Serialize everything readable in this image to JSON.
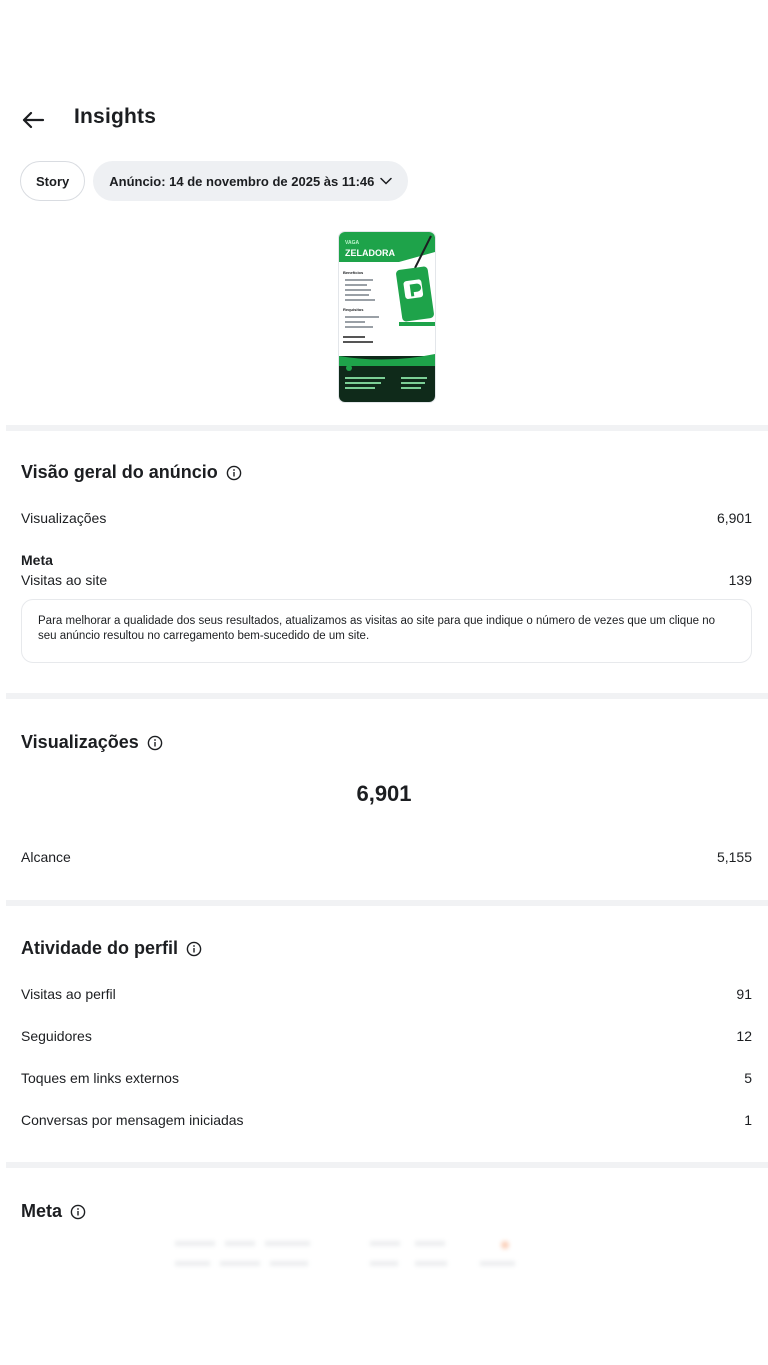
{
  "header": {
    "title": "Insights"
  },
  "chips": {
    "story": "Story",
    "ad_date": "Anúncio: 14 de novembro de 2025 às 11:46"
  },
  "thumbnail": {
    "headline_small": "VAGA",
    "headline": "ZELADORA",
    "benefits_title": "Benefícios",
    "requirements_title": "Requisitos",
    "brand_color": "#1ea34a"
  },
  "overview": {
    "title": "Visão geral do anúncio",
    "views_label": "Visualizações",
    "views_value": "6,901",
    "meta_heading": "Meta",
    "site_visits_label": "Visitas ao site",
    "site_visits_value": "139",
    "notice": "Para melhorar a qualidade dos seus resultados, atualizamos as visitas ao site para que indique o número de vezes que um clique no seu anúncio resultou no carregamento bem-sucedido de um site."
  },
  "views": {
    "title": "Visualizações",
    "total": "6,901",
    "reach_label": "Alcance",
    "reach_value": "5,155"
  },
  "profile_activity": {
    "title": "Atividade do perfil",
    "rows": [
      {
        "label": "Visitas ao perfil",
        "value": "91"
      },
      {
        "label": "Seguidores",
        "value": "12"
      },
      {
        "label": "Toques em links externos",
        "value": "5"
      },
      {
        "label": "Conversas por mensagem iniciadas",
        "value": "1"
      }
    ]
  },
  "meta_section": {
    "title": "Meta"
  },
  "icons": {
    "back": "arrow-left-icon",
    "chevron": "chevron-down-icon",
    "info": "info-circle-icon"
  }
}
